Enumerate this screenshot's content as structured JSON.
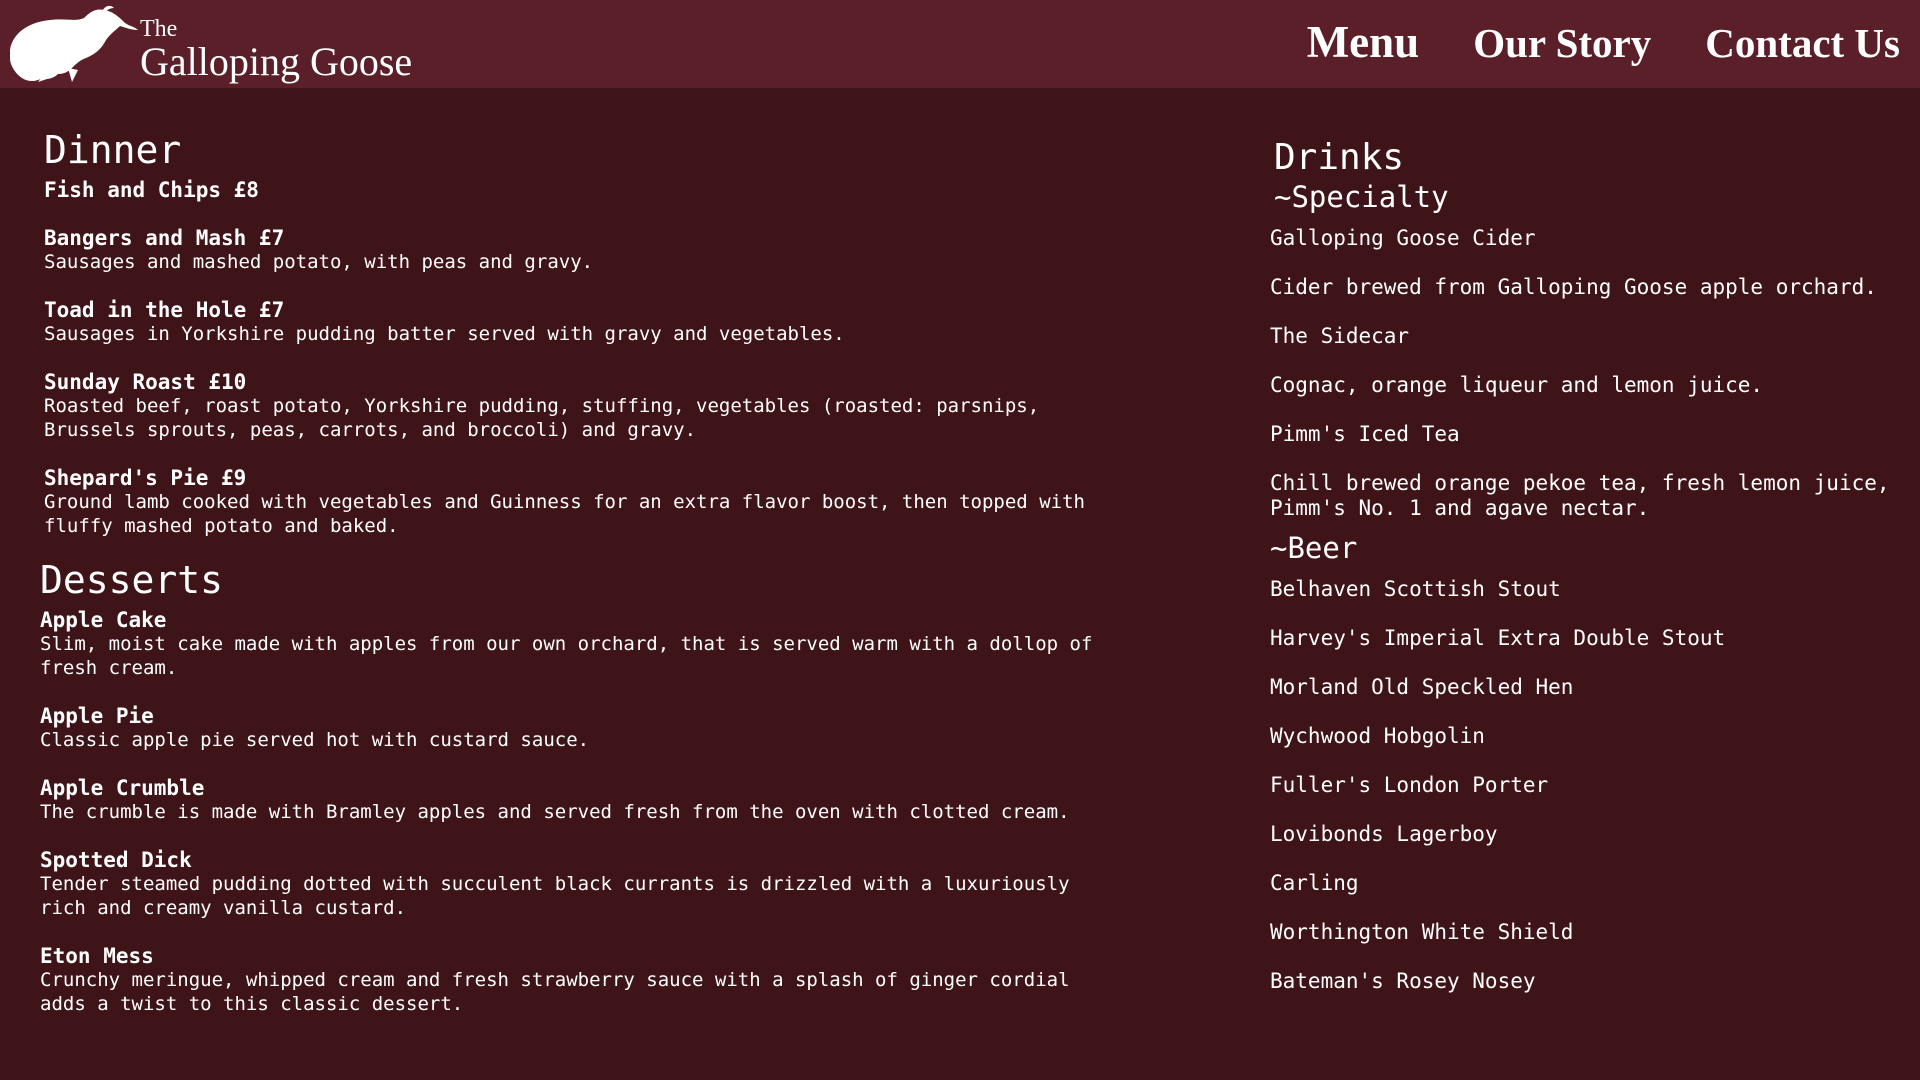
{
  "header": {
    "logo_the": "The",
    "logo_name": "Galloping Goose",
    "nav": [
      "Menu",
      "Our Story",
      "Contact Us"
    ]
  },
  "dinner": {
    "title": "Dinner",
    "items": [
      {
        "name": "Fish and Chips £8",
        "desc": ""
      },
      {
        "name": "Bangers and Mash £7",
        "desc": "Sausages and mashed potato, with peas and gravy."
      },
      {
        "name": "Toad in the Hole £7",
        "desc": "Sausages in Yorkshire pudding batter served with gravy and vegetables."
      },
      {
        "name": "Sunday Roast £10",
        "desc": "Roasted beef, roast potato, Yorkshire pudding, stuffing, vegetables (roasted: parsnips, Brussels sprouts, peas, carrots, and broccoli) and gravy."
      },
      {
        "name": "Shepard's Pie £9",
        "desc": "Ground lamb cooked with vegetables and Guinness for an extra flavor boost, then topped with fluffy mashed potato and baked."
      }
    ]
  },
  "desserts": {
    "title": "Desserts",
    "items": [
      {
        "name": "Apple Cake",
        "desc": "Slim, moist cake made with apples from our own orchard, that is served warm with a dollop of fresh cream."
      },
      {
        "name": "Apple Pie",
        "desc": "Classic apple pie served hot with custard sauce."
      },
      {
        "name": "Apple Crumble",
        "desc": "The crumble is made with Bramley apples and served fresh from the oven with clotted cream."
      },
      {
        "name": "Spotted Dick",
        "desc": "Tender steamed pudding dotted with succulent black currants is drizzled with a luxuriously rich and creamy vanilla custard."
      },
      {
        "name": "Eton Mess",
        "desc": "Crunchy meringue, whipped cream and fresh strawberry sauce with a splash of ginger cordial adds a twist to this classic dessert."
      }
    ]
  },
  "drinks": {
    "title": "Drinks",
    "specialty_title": "~Specialty",
    "specialty": [
      "Galloping Goose Cider",
      "Cider brewed from Galloping Goose apple orchard.",
      "The Sidecar",
      "Cognac, orange liqueur and lemon juice.",
      "Pimm's Iced Tea",
      "Chill brewed orange pekoe tea, fresh lemon juice,\nPimm's No. 1 and agave nectar."
    ],
    "beer_title": "~Beer",
    "beer": [
      "Belhaven Scottish Stout",
      "Harvey's Imperial Extra Double Stout",
      "Morland Old Speckled Hen",
      "Wychwood Hobgolin",
      "Fuller's London Porter",
      "Lovibonds Lagerboy",
      "Carling",
      "Worthington White Shield",
      "Bateman's Rosey Nosey"
    ]
  },
  "colors": {
    "header_bg": "#5a1f29",
    "page_bg": "#3f1418",
    "text": "#ffffff"
  }
}
